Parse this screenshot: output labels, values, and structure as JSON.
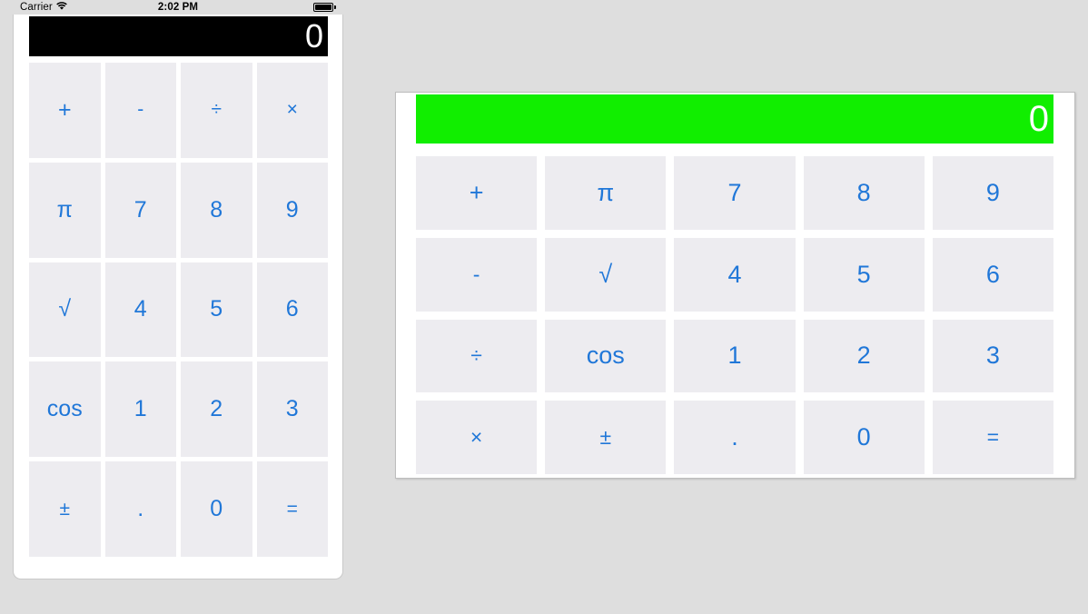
{
  "status_bar": {
    "carrier": "Carrier",
    "wifi_icon": "wifi-icon",
    "time": "2:02 PM",
    "battery_icon": "battery-full-icon"
  },
  "phone_calculator": {
    "display_value": "0",
    "display_background": "#000000",
    "display_text_color": "#ffffff",
    "key_color": "#2077d8",
    "key_background": "#edecf0",
    "keys": [
      {
        "label": "+",
        "name": "key-plus",
        "small": false
      },
      {
        "label": "-",
        "name": "key-minus",
        "small": true
      },
      {
        "label": "÷",
        "name": "key-divide",
        "small": true
      },
      {
        "label": "×",
        "name": "key-multiply",
        "small": true
      },
      {
        "label": "π",
        "name": "key-pi",
        "small": false
      },
      {
        "label": "7",
        "name": "key-7",
        "small": false
      },
      {
        "label": "8",
        "name": "key-8",
        "small": false
      },
      {
        "label": "9",
        "name": "key-9",
        "small": false
      },
      {
        "label": "√",
        "name": "key-sqrt",
        "small": false
      },
      {
        "label": "4",
        "name": "key-4",
        "small": false
      },
      {
        "label": "5",
        "name": "key-5",
        "small": false
      },
      {
        "label": "6",
        "name": "key-6",
        "small": false
      },
      {
        "label": "cos",
        "name": "key-cos",
        "small": false
      },
      {
        "label": "1",
        "name": "key-1",
        "small": false
      },
      {
        "label": "2",
        "name": "key-2",
        "small": false
      },
      {
        "label": "3",
        "name": "key-3",
        "small": false
      },
      {
        "label": "±",
        "name": "key-plusminus",
        "small": true
      },
      {
        "label": ".",
        "name": "key-decimal",
        "small": false
      },
      {
        "label": "0",
        "name": "key-0",
        "small": false
      },
      {
        "label": "=",
        "name": "key-equals",
        "small": true
      }
    ]
  },
  "landscape_calculator": {
    "display_value": "0",
    "display_background": "#11ee00",
    "display_text_color": "#ffffff",
    "key_color": "#2077d8",
    "key_background": "#edecf0",
    "keys": [
      {
        "label": "+",
        "name": "key-plus",
        "small": false
      },
      {
        "label": "π",
        "name": "key-pi",
        "small": false
      },
      {
        "label": "7",
        "name": "key-7",
        "small": false
      },
      {
        "label": "8",
        "name": "key-8",
        "small": false
      },
      {
        "label": "9",
        "name": "key-9",
        "small": false
      },
      {
        "label": "-",
        "name": "key-minus",
        "small": true
      },
      {
        "label": "√",
        "name": "key-sqrt",
        "small": false
      },
      {
        "label": "4",
        "name": "key-4",
        "small": false
      },
      {
        "label": "5",
        "name": "key-5",
        "small": false
      },
      {
        "label": "6",
        "name": "key-6",
        "small": false
      },
      {
        "label": "÷",
        "name": "key-divide",
        "small": true
      },
      {
        "label": "cos",
        "name": "key-cos",
        "small": false
      },
      {
        "label": "1",
        "name": "key-1",
        "small": false
      },
      {
        "label": "2",
        "name": "key-2",
        "small": false
      },
      {
        "label": "3",
        "name": "key-3",
        "small": false
      },
      {
        "label": "×",
        "name": "key-multiply",
        "small": true
      },
      {
        "label": "±",
        "name": "key-plusminus",
        "small": true
      },
      {
        "label": ".",
        "name": "key-decimal",
        "small": false
      },
      {
        "label": "0",
        "name": "key-0",
        "small": false
      },
      {
        "label": "=",
        "name": "key-equals",
        "small": true
      }
    ]
  }
}
